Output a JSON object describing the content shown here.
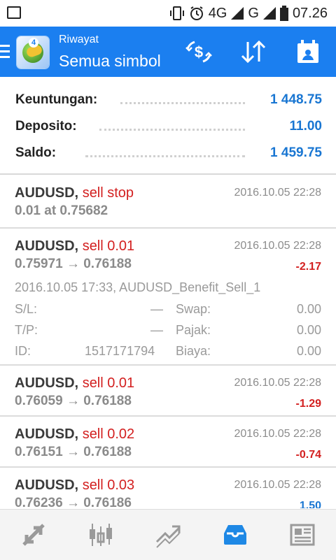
{
  "status_bar": {
    "network_4g": "4G",
    "network_g": "G",
    "time": "07.26"
  },
  "app_bar": {
    "subtitle": "Riwayat",
    "title": "Semua simbol",
    "logo_badge": "4",
    "actions": [
      "dollar-swap-icon",
      "sort-icon",
      "calendar-icon"
    ]
  },
  "summary": {
    "profit_label": "Keuntungan:",
    "profit_value": "1 448.75",
    "deposit_label": "Deposito:",
    "deposit_value": "11.00",
    "balance_label": "Saldo:",
    "balance_value": "1 459.75"
  },
  "orders": [
    {
      "symbol": "AUDUSD,",
      "direction": "sell stop",
      "price": "0.01 at 0.75682",
      "time": "2016.10.05 22:28",
      "profit": ""
    },
    {
      "symbol": "AUDUSD,",
      "direction": "sell 0.01",
      "price": "0.75971 → 0.76188",
      "time": "2016.10.05 22:28",
      "profit": "-2.17",
      "details": {
        "comment": "2016.10.05 17:33, AUDUSD_Benefit_Sell_1",
        "sl_label": "S/L:",
        "sl_value": "—",
        "tp_label": "T/P:",
        "tp_value": "—",
        "id_label": "ID:",
        "id_value": "1517171794",
        "swap_label": "Swap:",
        "swap_value": "0.00",
        "tax_label": "Pajak:",
        "tax_value": "0.00",
        "fee_label": "Biaya:",
        "fee_value": "0.00"
      }
    },
    {
      "symbol": "AUDUSD,",
      "direction": "sell 0.01",
      "price": "0.76059 → 0.76188",
      "time": "2016.10.05 22:28",
      "profit": "-1.29"
    },
    {
      "symbol": "AUDUSD,",
      "direction": "sell 0.02",
      "price": "0.76151 → 0.76188",
      "time": "2016.10.05 22:28",
      "profit": "-0.74"
    },
    {
      "symbol": "AUDUSD,",
      "direction": "sell 0.03",
      "price": "0.76236 → 0.76186",
      "time": "2016.10.05 22:28",
      "profit": "1.50"
    }
  ],
  "bottom_nav": [
    "quotes-icon",
    "chart-icon",
    "trade-icon",
    "history-icon",
    "news-icon"
  ],
  "colors": {
    "app_bar": "#1b7ff0",
    "positive": "#1976d2",
    "negative": "#d32020",
    "active_tab": "#1e88e5"
  }
}
